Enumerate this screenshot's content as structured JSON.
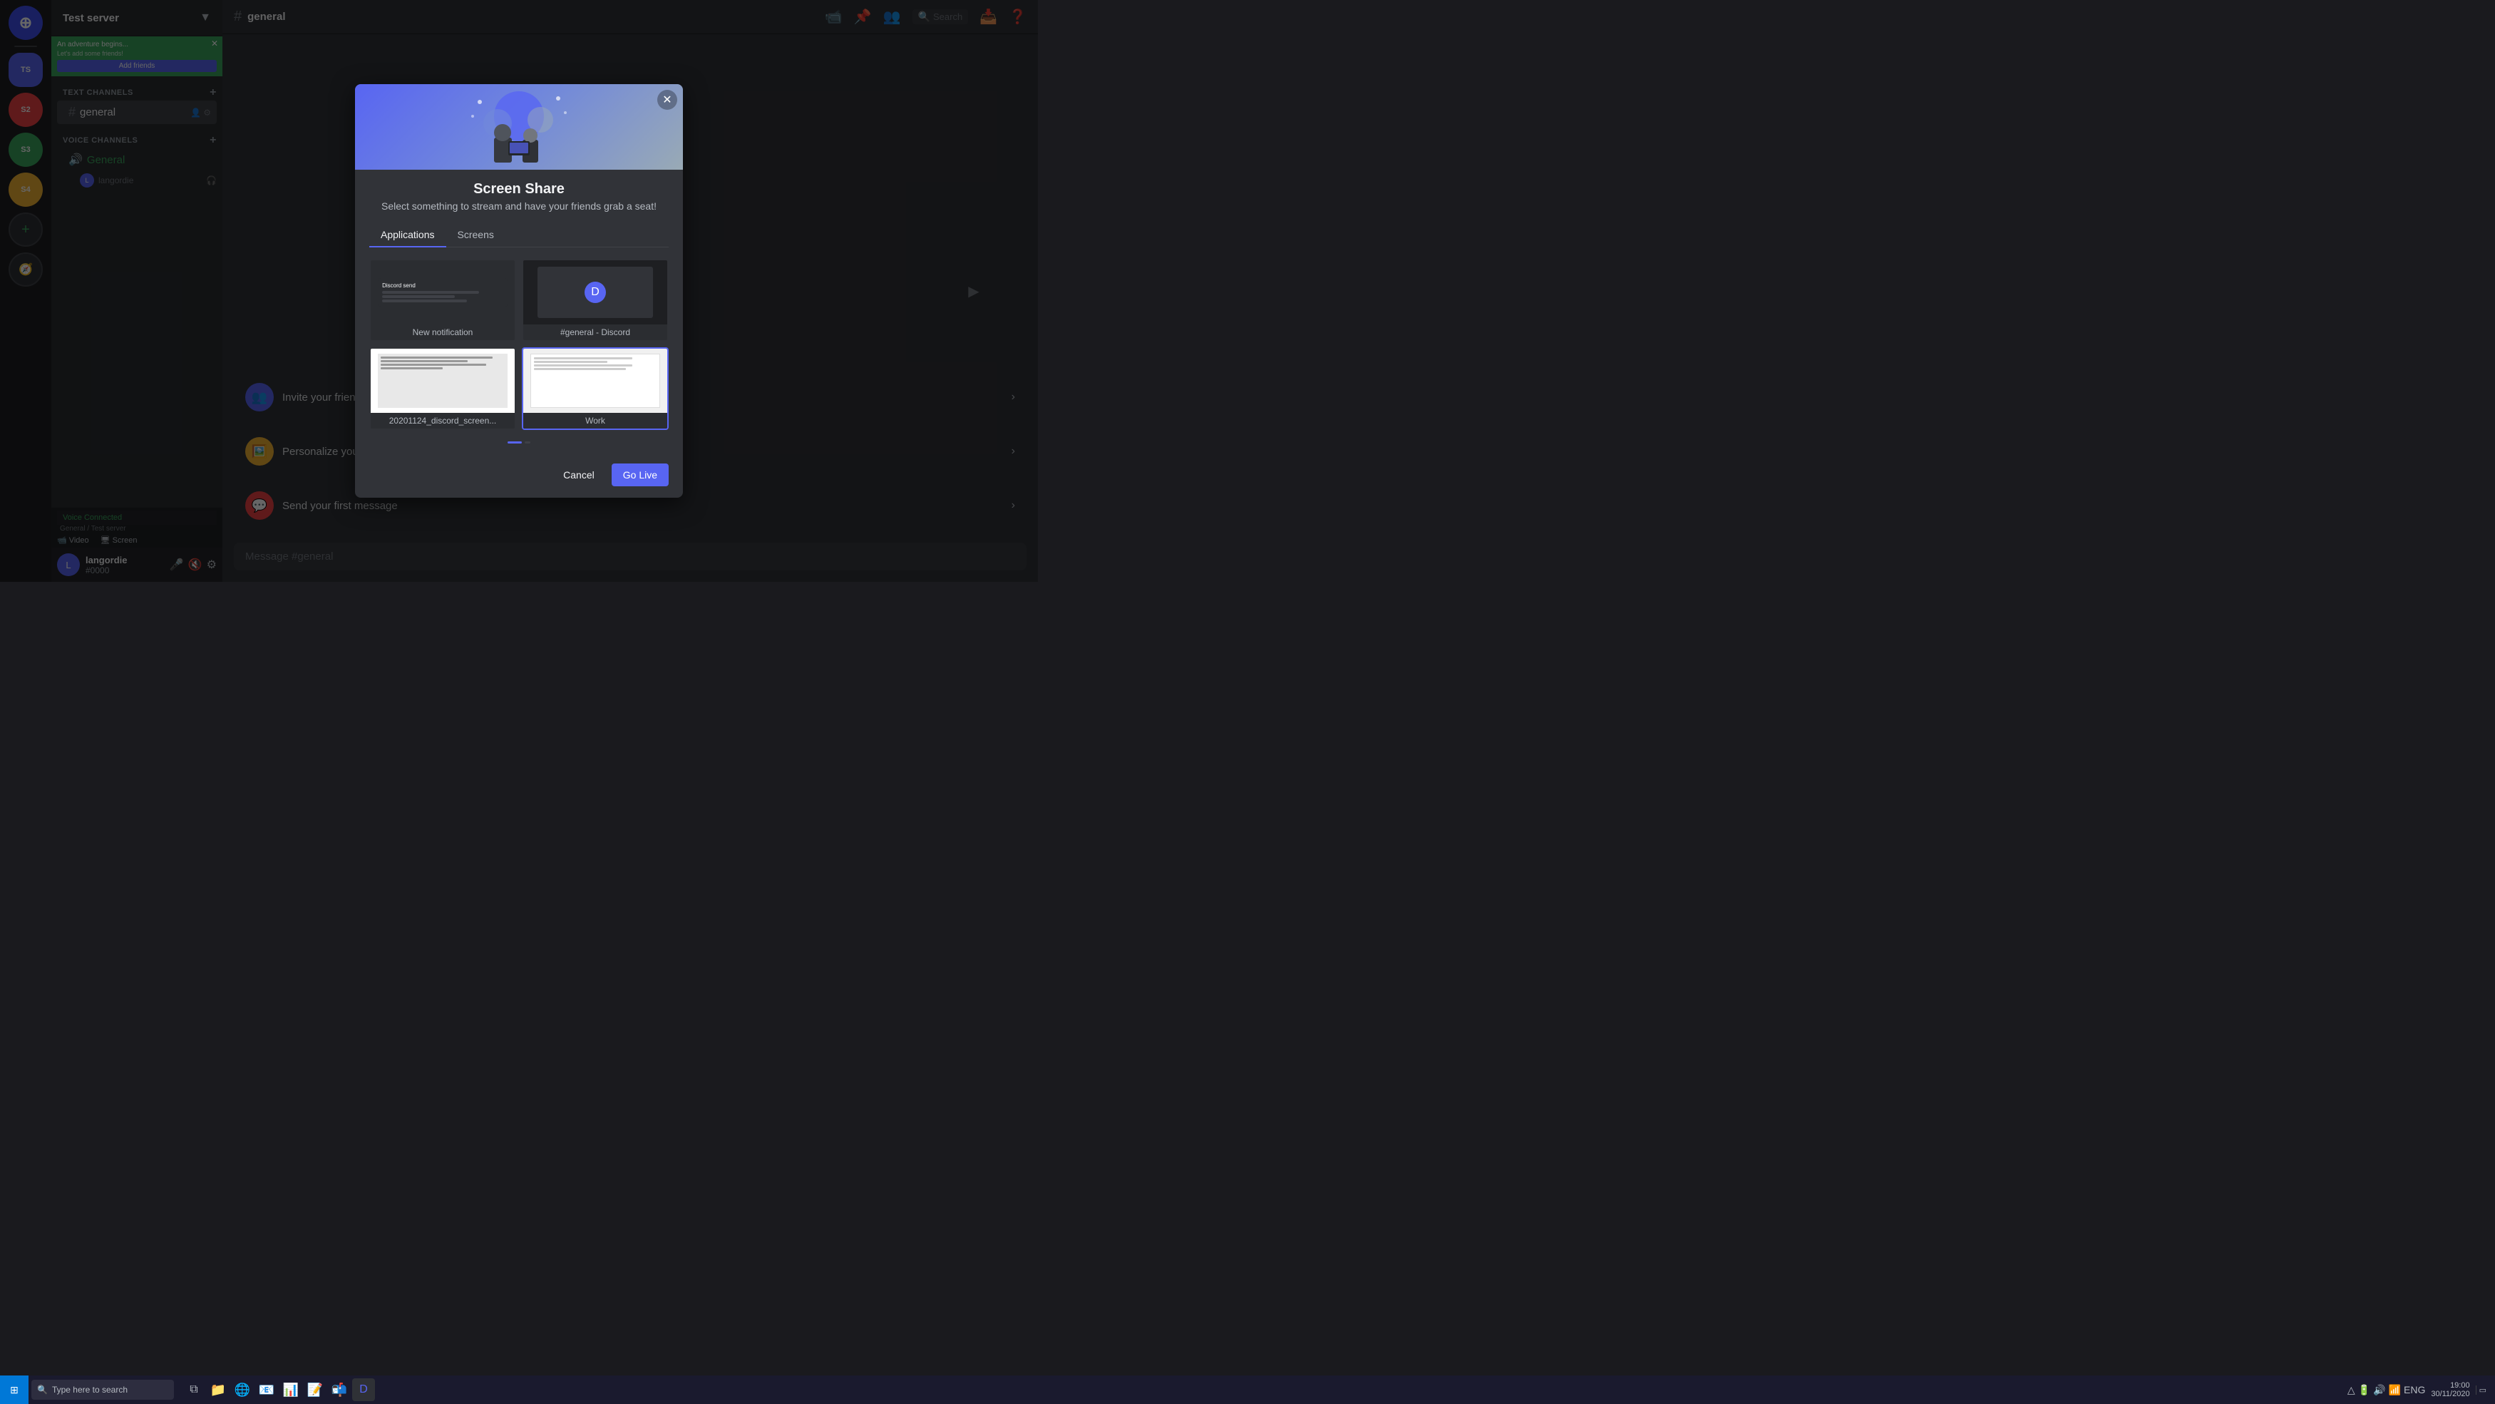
{
  "app": {
    "title": "DISCORD",
    "version": "Discord"
  },
  "server": {
    "name": "Test server",
    "chevron": "▼"
  },
  "channels": {
    "text_category": "TEXT CHANNELS",
    "voice_category": "VOICE CHANNELS",
    "add_icon": "+",
    "items": [
      {
        "id": "general",
        "name": "general",
        "type": "text",
        "active": true
      },
      {
        "id": "general-voice",
        "name": "General",
        "type": "voice",
        "active": false
      }
    ]
  },
  "user": {
    "name": "langordie",
    "discriminator": "#0000",
    "avatar": "L"
  },
  "header": {
    "channel_hash": "#",
    "channel_name": "general"
  },
  "voice_status": {
    "label": "Voice Connected",
    "channel": "General / Test server"
  },
  "setup_items": [
    {
      "id": "invite",
      "label": "Invite your friends",
      "icon": "👥"
    },
    {
      "id": "icon",
      "label": "Personalize your server with an icon",
      "icon": "🖼️"
    },
    {
      "id": "message",
      "label": "Send your first message",
      "icon": "💬"
    }
  ],
  "message_input": {
    "placeholder": "Message #general"
  },
  "modal": {
    "title": "Screen Share",
    "subtitle": "Select something to stream and have your friends grab a seat!",
    "close_label": "✕",
    "tabs": [
      {
        "id": "applications",
        "label": "Applications",
        "active": true
      },
      {
        "id": "screens",
        "label": "Screens",
        "active": false
      }
    ],
    "apps": [
      {
        "id": "notification",
        "label": "New notification",
        "type": "notification"
      },
      {
        "id": "discord",
        "label": "#general - Discord",
        "type": "discord"
      },
      {
        "id": "screenshot",
        "label": "20201124_discord_screen...",
        "type": "screenshot"
      },
      {
        "id": "work",
        "label": "Work",
        "type": "work"
      }
    ],
    "buttons": {
      "cancel": "Cancel",
      "go_live": "Go Live"
    },
    "scroll_dots": [
      {
        "active": true
      },
      {
        "active": false
      }
    ]
  },
  "taskbar": {
    "search_placeholder": "Type here to search",
    "time": "19:00",
    "date": "30/11/2020",
    "apps": [
      "⊞",
      "🔍",
      "⧉",
      "📁",
      "🌐",
      "📧",
      "📝",
      "📊",
      "🗒️"
    ]
  }
}
